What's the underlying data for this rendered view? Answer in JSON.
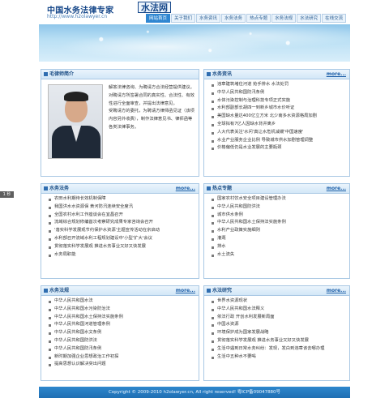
{
  "side_tab": "1 秒",
  "header": {
    "title": "中国水务法律专家",
    "badge": "水法网",
    "url": "http://www.h2olawyer.cn"
  },
  "nav": {
    "items": [
      "网站首页",
      "关于我们",
      "水务资讯",
      "水务法务",
      "热点专题",
      "水务法规",
      "水法研究",
      "在线交流"
    ]
  },
  "lawyer": {
    "title": "毛律师简介",
    "paragraphs": [
      "解答法律咨询、为聘请方合法经营提供建议。",
      "对聘请方所签署合同的真实性、合法性、有效性进行全面审查，并提出法律意见。",
      "受聘请方的委托，为聘请方律师函见证（该项内容另外收费），制作法律意见书、律师函等各类法律事务。"
    ]
  },
  "news": {
    "title": "水务资讯",
    "more": "more...",
    "items": [
      "违章建筑堵住河道 抢手排水 水法处罚",
      "中华人民共和国防汛条例",
      "水体污染控制与治理科技专项正式实施",
      "水利部副部长胡四一到新乡城市水价听证",
      "美国缺水量达400亿立方米 北少南多水资源格局加剧",
      "全球拟有7亿人因缺水背井离乡",
      "人大代表关注'水问'真让水危机减缓'中国速度'",
      "水业产业服务企业比例 导致城市供水加剧管理调整",
      "价格偏低仍是水业发展的主要瓶颈"
    ]
  },
  "water_law": {
    "title": "水务法务",
    "more": "more...",
    "items": [
      "农田水利期待长效机制保障",
      "我国洪水水资源保 黄河防汛连续安全度汛",
      "全国农村水利工作座谈会在宜昌召开",
      "流域综合规划修编首次考察研究成果专家咨询会召开",
      "'落实科学发展观节约保护水资源'主题宣传活动在京启动",
      "水利部召开流域水利工程规划建设中'小型'扩大'会议",
      "贯彻落实科学发展观 推进水务事业又好又快发展",
      "水务局职能"
    ]
  },
  "hotspot": {
    "title": "热点专题",
    "more": "more...",
    "items": [
      "国家农村饮水安全项目建设管理办法",
      "中华人民共和国防洪法",
      "城市供水条例",
      "中华人民共和国水土保持法实施条例",
      "水利产业政策实施细则",
      "灌溉",
      "排水",
      "水土流失"
    ]
  },
  "regulation": {
    "title": "水务法规",
    "more": "more...",
    "items": [
      "中华人民共和国水法",
      "中华人民共和国水污染防治法",
      "中华人民共和国水土保持法实施条例",
      "中华人民共和国河道管理条例",
      "中华人民共和国水文条例",
      "中华人民共和国防洪法",
      "中华人民共和国防汛条例",
      "新时期加强企业思想政治工作初探",
      "提高思想认识解决突出问题"
    ]
  },
  "research": {
    "title": "水法研究",
    "more": "more...",
    "items": [
      "世界水资源现状",
      "中华人民共和国水法释义",
      "依法行政 开创水利发展新局面",
      "中国水资源",
      "环境保护成为国家发展战略",
      "贯彻落实科学发展观 推进水务事业又好又快发展",
      "生活中遇到日常水务纠纷：发现，发白到违章该去哪办理",
      "生活中五种水不要喝"
    ]
  },
  "footer": {
    "text": "Copyright © 2009-2010 h2olawyer.cn, All right reserved! 粤ICP备09047880号"
  }
}
